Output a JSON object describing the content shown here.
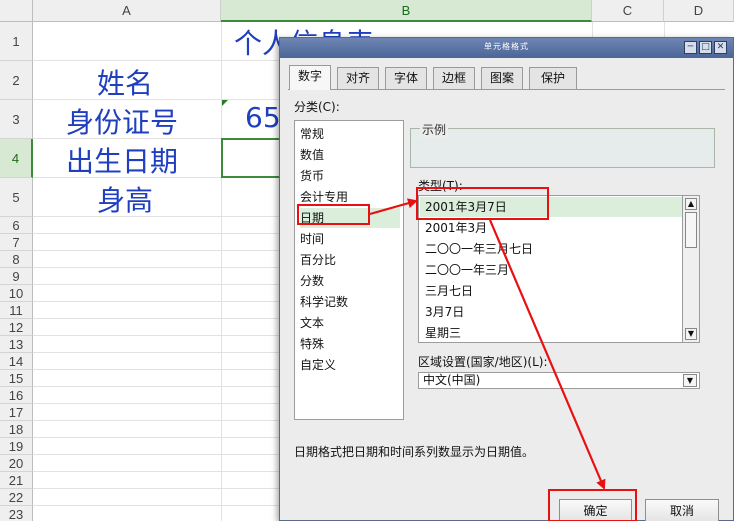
{
  "sheet": {
    "columns": [
      "A",
      "B",
      "C",
      "D"
    ],
    "rows": [
      "1",
      "2",
      "3",
      "4",
      "5",
      "6",
      "7",
      "8",
      "9",
      "10",
      "11",
      "12",
      "13",
      "14",
      "15",
      "16",
      "17",
      "18",
      "19",
      "20",
      "21",
      "22",
      "23"
    ],
    "cells": {
      "title": "个人信息表",
      "name_label": "姓名",
      "id_label": "身份证号",
      "id_value_prefix": "65",
      "birth_label": "出生日期",
      "height_label": "身高"
    }
  },
  "dialog": {
    "title": "单元格格式",
    "tabs": [
      "数字",
      "对齐",
      "字体",
      "边框",
      "图案",
      "保护"
    ],
    "active_tab": "数字",
    "category_label": "分类(C):",
    "categories": [
      "常规",
      "数值",
      "货币",
      "会计专用",
      "日期",
      "时间",
      "百分比",
      "分数",
      "科学记数",
      "文本",
      "特殊",
      "自定义"
    ],
    "selected_category": "日期",
    "sample_label": "示例",
    "type_label": "类型(T):",
    "types": [
      "2001年3月7日",
      "2001年3月",
      "二〇〇一年三月七日",
      "二〇〇一年三月",
      "三月七日",
      "3月7日",
      "星期三"
    ],
    "selected_type": "2001年3月7日",
    "locale_label": "区域设置(国家/地区)(L):",
    "locale_value": "中文(中国)",
    "description": "日期格式把日期和时间系列数显示为日期值。",
    "ok_label": "确定",
    "cancel_label": "取消"
  },
  "colors": {
    "cell_text": "#1f3fbf",
    "annotation": "#e81010",
    "selection_green": "#3d8a3d",
    "titlebar": "#4b6597"
  }
}
